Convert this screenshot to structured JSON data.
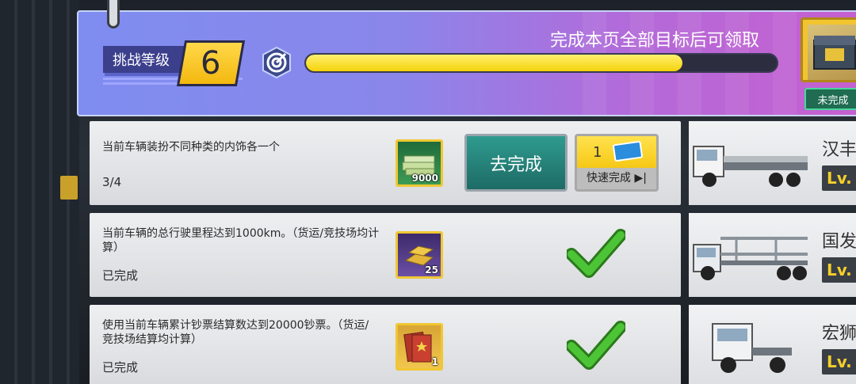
{
  "header": {
    "level_label": "挑战等级",
    "level_value": "6",
    "title": "完成本页全部目标后可领取",
    "progress": 0.8,
    "reward_status": "未完成"
  },
  "tasks": [
    {
      "description": "当前车辆装扮不同种类的内饰各一个",
      "status": "3/4",
      "reward_icon": "cash-stack-icon",
      "reward_count": "9000",
      "go_label": "去完成",
      "quick_count": "1",
      "quick_label": "快速完成 ▶|",
      "completed": false
    },
    {
      "description": "当前车辆的总行驶里程达到1000km。（货运/竞技场均计算）",
      "status": "已完成",
      "reward_icon": "gold-bar-icon",
      "reward_count": "25",
      "completed": true
    },
    {
      "description": "使用当前车辆累计钞票结算数达到20000钞票。（货运/竞技场结算均计算）",
      "status": "已完成",
      "reward_icon": "ticket-icon",
      "reward_count": "1",
      "completed": true
    }
  ],
  "vehicles": [
    {
      "name": "汉丰",
      "level": "Lv."
    },
    {
      "name": "国发",
      "level": "Lv."
    },
    {
      "name": "宏狮",
      "level": "Lv."
    }
  ],
  "colors": {
    "banner_left": "#7f8df0",
    "banner_right": "#c65fcf",
    "progress_fill": "#f5d20a",
    "go_button": "#1d6b66",
    "check_green": "#3fae2a"
  }
}
